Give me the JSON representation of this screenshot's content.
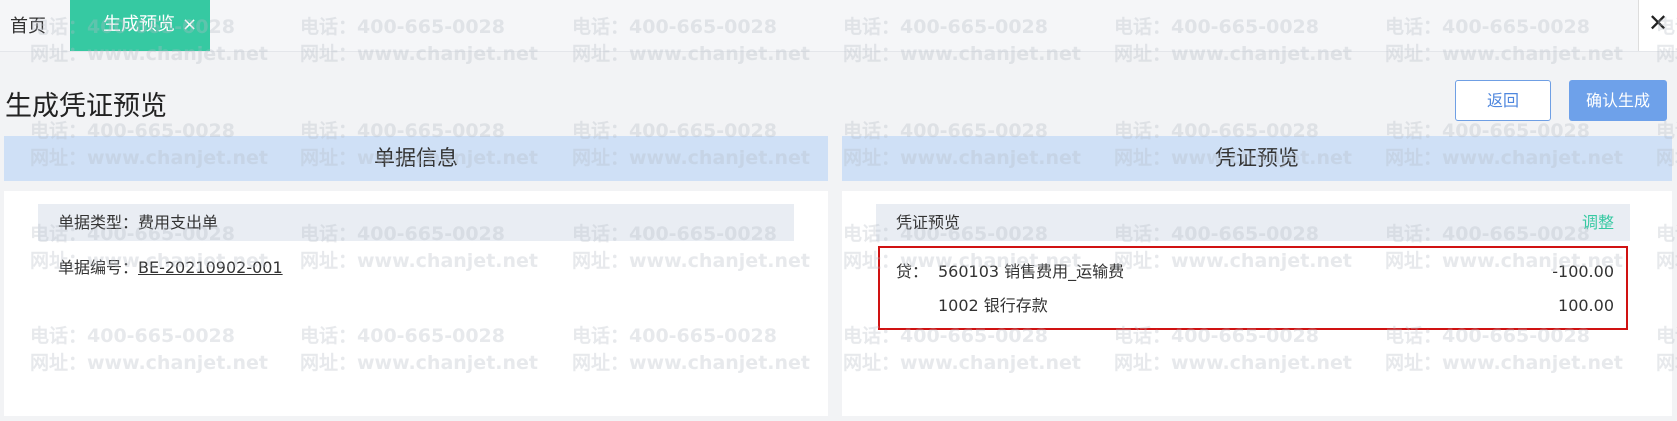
{
  "tabs": {
    "home": "首页",
    "active": "生成预览",
    "active_close": "×"
  },
  "window": {
    "close": "✕"
  },
  "page": {
    "title": "生成凭证预览",
    "back_button": "返回",
    "confirm_button": "确认生成"
  },
  "left_panel": {
    "header": "单据信息",
    "doc_type_label": "单据类型：",
    "doc_type_value": "费用支出单",
    "doc_no_label": "单据编号：",
    "doc_no_value": "BE-20210902-001"
  },
  "right_panel": {
    "header": "凭证预览",
    "subheader": "凭证预览",
    "adjust_link": "调整",
    "entries": [
      {
        "direction": "贷：",
        "account": "560103  销售费用_运输费",
        "amount": "-100.00"
      },
      {
        "direction": "",
        "account": "1002  银行存款",
        "amount": "100.00"
      }
    ]
  },
  "watermark": {
    "phone": "电话：400-665-0028",
    "site": "网址：www.chanjet.net"
  },
  "colors": {
    "accent_green": "#36c9a2",
    "primary_blue": "#6ea1ea",
    "panel_header_blue": "#cfe0f6",
    "highlight_red": "#d01212"
  }
}
